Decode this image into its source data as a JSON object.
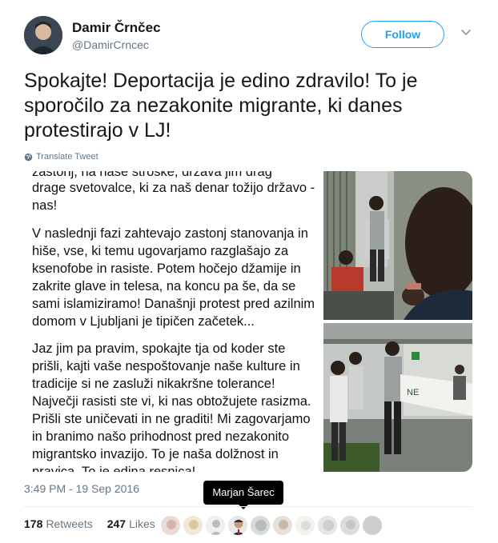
{
  "author": {
    "name": "Damir Črnčec",
    "handle": "@DamirCrncec"
  },
  "follow_label": "Follow",
  "tweet": {
    "text": "Spokajte! Deportacija je edino zdravilo! To je sporočilo za nezakonite migrante, ki danes protestirajo v LJ!",
    "translate_label": "Translate Tweet",
    "timestamp": "3:49 PM - 19 Sep 2016"
  },
  "image_text": {
    "cut_line": "zastonj, na naše stroške, država jim drag",
    "line_1": "drage svetovalce, ki za naš denar tožijo državo - nas!",
    "para_2": "V naslednji fazi zahtevajo zastonj stanovanja in hiše, vse, ki temu ugovarjamo razglašajo za ksenofobe in rasiste. Potem hočejo džamije in zakrite glave in telesa, na koncu pa še, da se sami islamiziramo! Današnji protest pred azilnim domom v Ljubljani je tipičen začetek...",
    "para_3": "Jaz jim pa pravim, spokajte tja od koder ste prišli, kajti vaše nespoštovanje naše kulture in tradicije si ne zasluži nikakršne tolerance! Največji rasisti ste vi, ki nas obtožujete rasizma. Prišli ste uničevati in ne graditi! Mi zagovarjamo in branimo našo prihodnost pred nezakonito migrantsko invazijo. To je naša dolžnost in pravica. To je edina resnica!"
  },
  "stats": {
    "retweets_count": "178",
    "retweets_label": "Retweets",
    "likes_count": "247",
    "likes_label": "Likes"
  },
  "tooltip": "Marjan Šarec",
  "icons": {
    "chevron": "chevron-down-icon",
    "translate": "globe-icon"
  },
  "colors": {
    "accent": "#1da1f2",
    "secondary_text": "#657786",
    "primary_text": "#14171a"
  }
}
